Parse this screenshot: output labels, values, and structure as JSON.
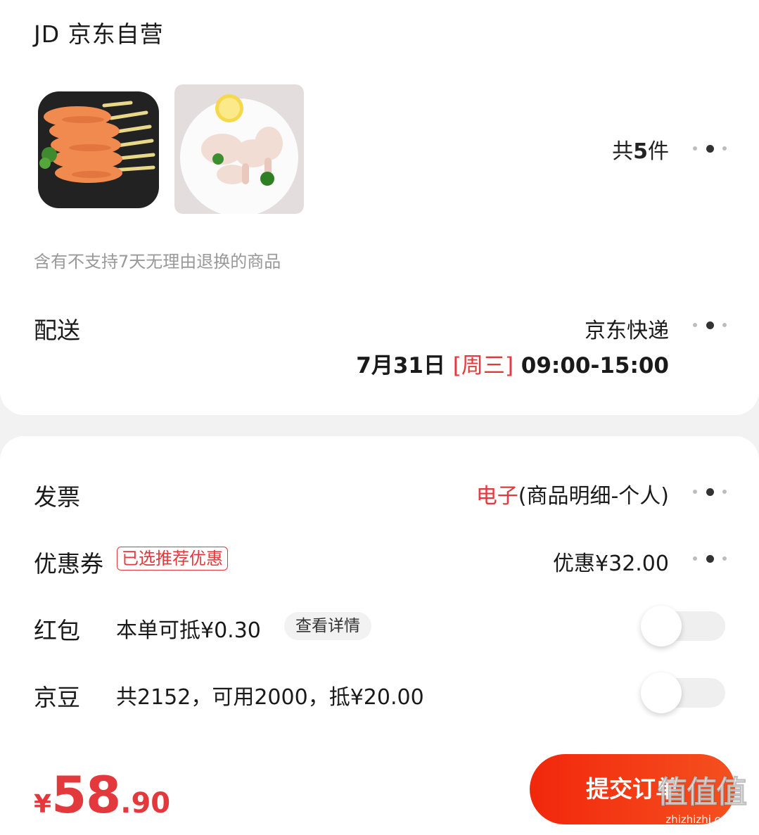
{
  "store": {
    "logo_text": "JD",
    "name": "京东自营"
  },
  "products": {
    "thumbs": [
      {
        "icon": "chicken-skewers-image"
      },
      {
        "icon": "chicken-drumsticks-image"
      }
    ],
    "count_prefix": "共",
    "count": "5",
    "count_suffix": "件",
    "return_notice": "含有不支持7天无理由退换的商品"
  },
  "delivery": {
    "label": "配送",
    "method": "京东快递",
    "date": "7月31日",
    "weekday": "[周三]",
    "time": "09:00-15:00"
  },
  "invoice": {
    "label": "发票",
    "type": "电子",
    "detail": "(商品明细-个人)"
  },
  "coupon": {
    "label": "优惠券",
    "tag": "已选推荐优惠",
    "value": "优惠¥32.00"
  },
  "red_packet": {
    "label": "红包",
    "text": "本单可抵¥0.30",
    "details_button": "查看详情",
    "enabled": false
  },
  "jingdou": {
    "label": "京豆",
    "text": "共2152，可用2000，抵¥20.00",
    "enabled": false
  },
  "footer": {
    "price_currency": "¥",
    "price_integer": "58",
    "price_decimal": ".90",
    "submit_label": "提交订单"
  },
  "watermark": {
    "glyphs": "值值值",
    "url": "zhizhizhi.com"
  },
  "colors": {
    "accent": "#e4393c",
    "button": "#f2270c"
  }
}
